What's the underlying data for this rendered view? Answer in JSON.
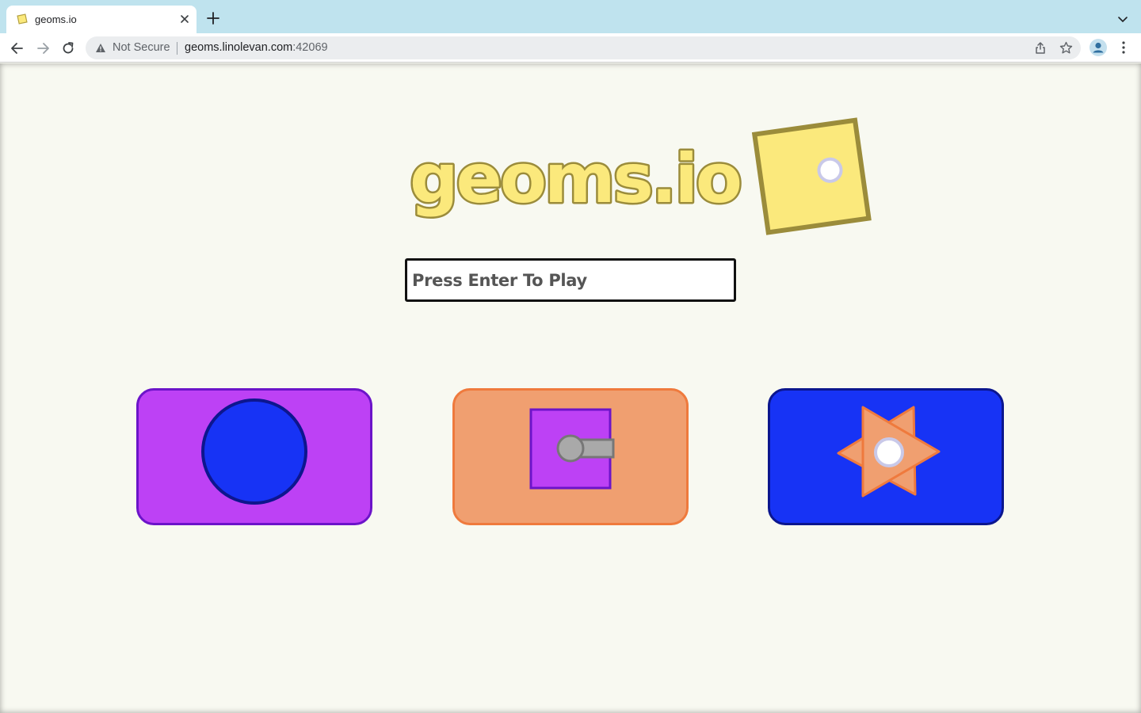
{
  "browser": {
    "tab_title": "geoms.io",
    "security_label": "Not Secure",
    "url_host": "geoms.linolevan.com",
    "url_port": ":42069"
  },
  "page": {
    "logo_text": "geoms.io",
    "name_input_placeholder": "Press Enter To Play",
    "colors": {
      "background": "#f8f9f1",
      "logo_fill": "#fbe97c",
      "logo_outline": "#9b8c3b",
      "purple": "#bd41f5",
      "orange": "#f09f70",
      "blue": "#1733f5"
    },
    "class_cards": [
      {
        "name": "circle-class",
        "icon": "blue-circle-icon"
      },
      {
        "name": "square-cannon-class",
        "icon": "purple-square-cannon-icon"
      },
      {
        "name": "star-class",
        "icon": "orange-star-icon"
      }
    ]
  }
}
